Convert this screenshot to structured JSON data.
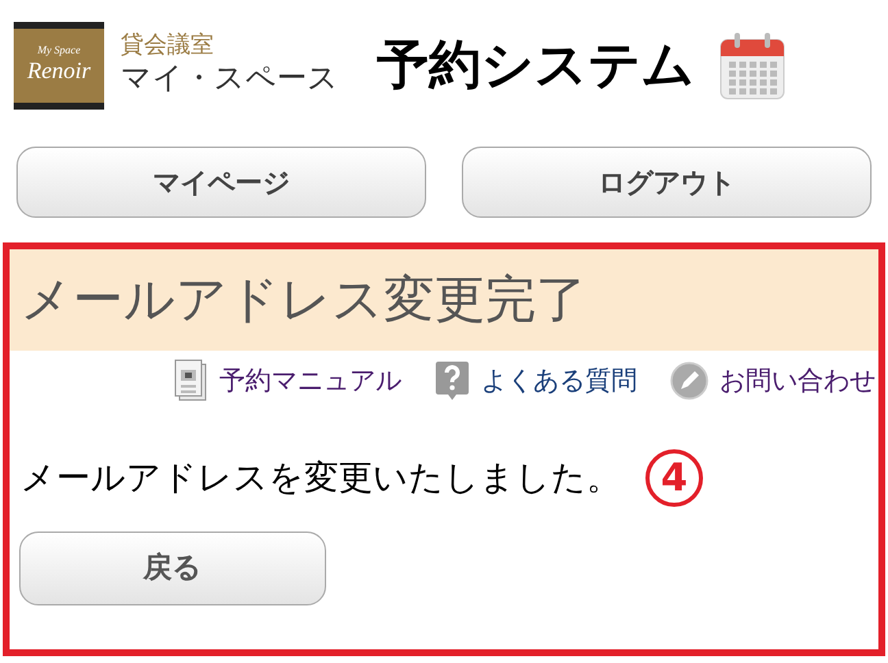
{
  "logo": {
    "tagline": "My Space",
    "brand": "Renoir",
    "line1": "貸会議室",
    "line2": "マイ・スペース"
  },
  "header": {
    "title": "予約システム"
  },
  "nav_buttons": [
    "マイページ",
    "ログアウト"
  ],
  "panel": {
    "title": "メールアドレス変更完了",
    "links": [
      {
        "kind": "manual",
        "label": "予約マニュアル"
      },
      {
        "kind": "faq",
        "label": "よくある質問"
      },
      {
        "kind": "contact",
        "label": "お問い合わせ"
      }
    ],
    "message": "メールアドレスを変更いたしました。",
    "step": "4",
    "back_button": "戻る"
  }
}
